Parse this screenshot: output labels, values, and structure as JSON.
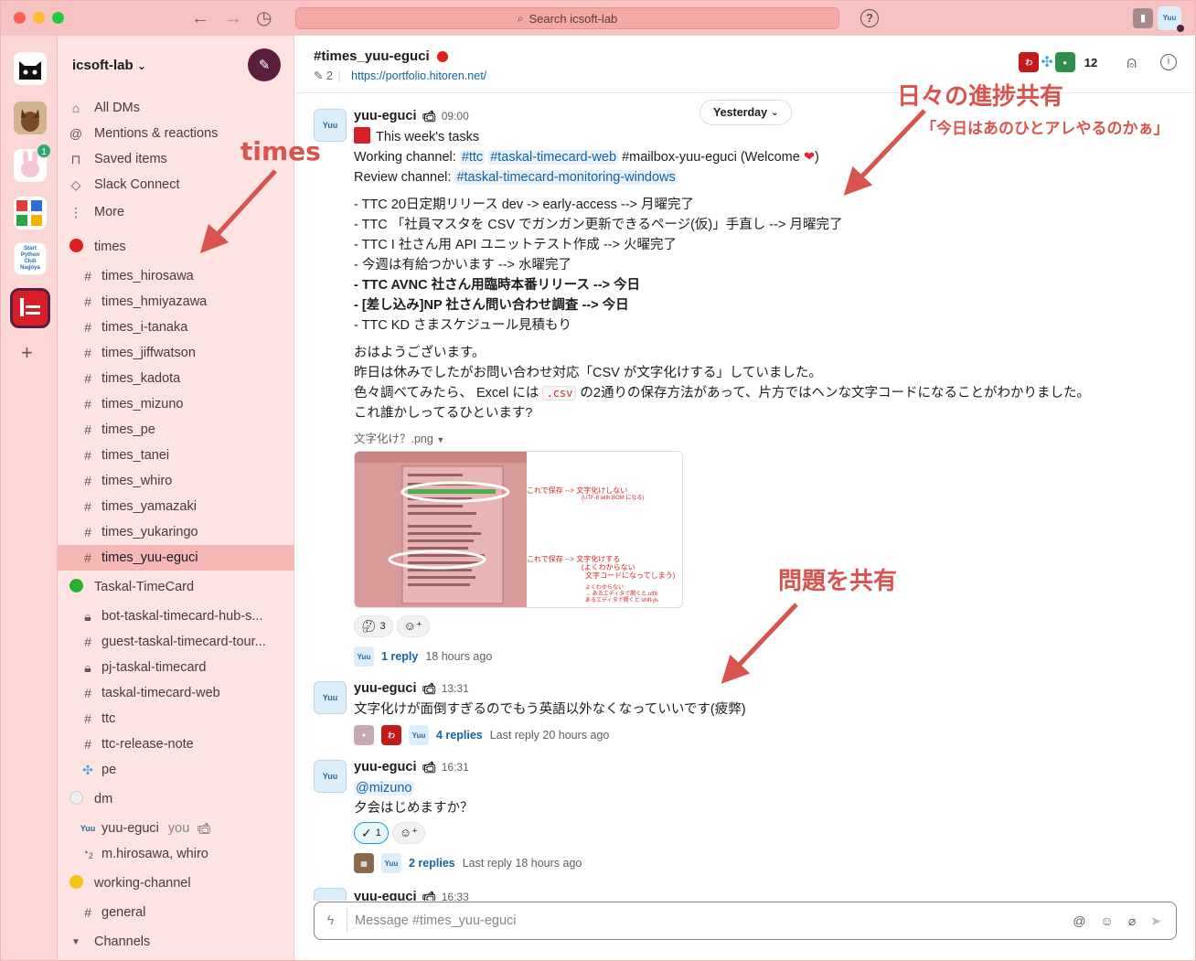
{
  "search": {
    "placeholder": "Search icsoft-lab"
  },
  "workspace": {
    "name": "icsoft-lab",
    "caret": "⌄"
  },
  "rail": {
    "badge_count": "1",
    "add": "+",
    "start_python_label": "Start Python Club Nagoya"
  },
  "sidebar": {
    "nav": [
      {
        "label": "All DMs"
      },
      {
        "label": "Mentions & reactions"
      },
      {
        "label": "Saved items"
      },
      {
        "label": "Slack Connect"
      },
      {
        "label": "More"
      }
    ],
    "groups": {
      "times": "times",
      "taskal": "Taskal-TimeCard",
      "dm": "dm",
      "working": "working-channel",
      "channels": "Channels"
    },
    "times_channels": [
      "times_hirosawa",
      "times_hmiyazawa",
      "times_i-tanaka",
      "times_jiffwatson",
      "times_kadota",
      "times_mizuno",
      "times_pe",
      "times_tanei",
      "times_whiro",
      "times_yamazaki",
      "times_yukaringo",
      "times_yuu-eguci"
    ],
    "taskal_channels": [
      "bot-taskal-timecard-hub-s...",
      "guest-taskal-timecard-tour...",
      "pj-taskal-timecard",
      "taskal-timecard-web",
      "ttc",
      "ttc-release-note",
      "pe"
    ],
    "dm_items": [
      {
        "label": "yuu-eguci",
        "you": "you"
      },
      {
        "label": "m.hirosawa, whiro",
        "count": "2"
      }
    ],
    "working_channels": [
      "general"
    ]
  },
  "channel": {
    "title": "#times_yuu-eguci",
    "pins": "2",
    "url": "https://portfolio.hitoren.net/",
    "member_count": "12",
    "date_divider": "Yesterday"
  },
  "messages": {
    "m1": {
      "author": "yuu-eguci",
      "time": "09:00",
      "line1": "This week's tasks",
      "working_prefix": "Working channel:",
      "working_ch1": "#ttc",
      "working_ch2": "#taskal-timecard-web",
      "working_rest": "#mailbox-yuu-eguci (Welcome",
      "working_close": ")",
      "review_prefix": "Review channel:",
      "review_ch": "#taskal-timecard-monitoring-windows",
      "tasks": [
        "- TTC 20日定期リリース dev -> early-access  --> 月曜完了",
        "- TTC 「社員マスタを CSV でガンガン更新できるページ(仮)」手直し  --> 月曜完了",
        "- TTC I 社さん用 API ユニットテスト作成  --> 火曜完了",
        "- 今週は有給つかいます  --> 水曜完了"
      ],
      "tasks_bold": [
        "- TTC AVNC 社さん用臨時本番リリース  --> 今日",
        "- [差し込み]NP 社さん問い合わせ調査  --> 今日"
      ],
      "task_last": "- TTC KD さまスケジュール見積もり",
      "p1": "おはようございます。",
      "p2": "昨日は休みでしたがお問い合わせ対応「CSV が文字化けする」していました。",
      "p3_pre": "色々調べてみたら、 Excel には ",
      "p3_code": ".csv",
      "p3_post": " の2通りの保存方法があって、片方ではヘンな文字コードになることがわかりました。",
      "p4": "これ誰かしってるひといます?",
      "file_name": "文字化け？.png",
      "reaction_count": "3",
      "replies": "1 reply",
      "reply_time": "18 hours ago"
    },
    "m2": {
      "author": "yuu-eguci",
      "time": "13:31",
      "text": "文字化けが面倒すぎるのでもう英語以外なくなっていいです(疲弊)",
      "replies": "4 replies",
      "reply_time": "Last reply 20 hours ago"
    },
    "m3": {
      "author": "yuu-eguci",
      "time": "16:31",
      "mention": "@mizuno",
      "text": "夕会はじめますか？",
      "reaction_count": "1",
      "replies": "2 replies",
      "reply_time": "Last reply 18 hours ago"
    },
    "m4": {
      "author": "yuu-eguci",
      "time": "16:33"
    }
  },
  "thumbnail": {
    "note1": "これで保存 --> 文字化けしない",
    "note1b": "(UTF-8 with BOM になる)",
    "note2": "これで保存 --> 文字化けする",
    "note2b": "(よくわからない",
    "note2c": "文字コードになってしまう)",
    "note3": "よくわからない",
    "note3b": "→ あるエディタで開くと utf8",
    "note3c": "あるエディタで開くと shift-jis"
  },
  "composer": {
    "placeholder": "Message #times_yuu-eguci"
  },
  "annotations": {
    "times": "times",
    "progress": "日々の進捗共有",
    "progress_sub": "「今日はあのひとアレやるのかぁ」",
    "problem": "問題を共有"
  },
  "colors": {
    "titlebar": "#f7c3c2",
    "sidebar": "#fde3e2",
    "accent_red": "#d9534f",
    "link": "#1264a3"
  }
}
